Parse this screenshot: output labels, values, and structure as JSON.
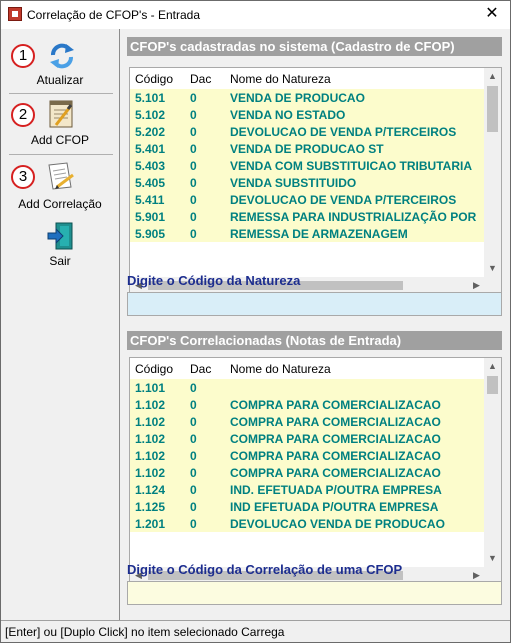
{
  "window": {
    "title": "Correlação de CFOP's - Entrada",
    "close_symbol": "✕"
  },
  "sidebar": {
    "buttons": [
      {
        "number": "1",
        "label": "Atualizar",
        "icon": "refresh-icon"
      },
      {
        "number": "2",
        "label": "Add CFOP",
        "icon": "notepad-icon"
      },
      {
        "number": "3",
        "label": "Add Correlação",
        "icon": "edit-document-icon"
      },
      {
        "number": "",
        "label": "Sair",
        "icon": "exit-door-icon"
      }
    ]
  },
  "cfop_cadastradas": {
    "title": "CFOP's cadastradas no sistema (Cadastro de CFOP)",
    "columns": [
      "Código",
      "Dac",
      "Nome do Natureza"
    ],
    "rows": [
      {
        "codigo": "5.101",
        "dac": "0",
        "nome": "VENDA DE PRODUCAO"
      },
      {
        "codigo": "5.102",
        "dac": "0",
        "nome": "VENDA NO ESTADO"
      },
      {
        "codigo": "5.202",
        "dac": "0",
        "nome": "DEVOLUCAO DE VENDA P/TERCEIROS"
      },
      {
        "codigo": "5.401",
        "dac": "0",
        "nome": "VENDA DE PRODUCAO ST"
      },
      {
        "codigo": "5.403",
        "dac": "0",
        "nome": "VENDA COM SUBSTITUICAO TRIBUTARIA"
      },
      {
        "codigo": "5.405",
        "dac": "0",
        "nome": "VENDA SUBSTITUIDO"
      },
      {
        "codigo": "5.411",
        "dac": "0",
        "nome": "DEVOLUCAO DE VENDA P/TERCEIROS"
      },
      {
        "codigo": "5.901",
        "dac": "0",
        "nome": "REMESSA PARA INDUSTRIALIZAÇÃO POR"
      },
      {
        "codigo": "5.905",
        "dac": "0",
        "nome": "REMESSA DE ARMAZENAGEM"
      }
    ]
  },
  "natureza_input": {
    "label": "Digite o Código da Natureza",
    "value": "",
    "background": "#d9eef8"
  },
  "cfop_correlacionadas": {
    "title": "CFOP's Correlacionadas (Notas de Entrada)",
    "columns": [
      "Código",
      "Dac",
      "Nome do Natureza"
    ],
    "rows": [
      {
        "codigo": "1.101",
        "dac": "0",
        "nome": ""
      },
      {
        "codigo": "1.102",
        "dac": "0",
        "nome": "COMPRA PARA COMERCIALIZACAO"
      },
      {
        "codigo": "1.102",
        "dac": "0",
        "nome": "COMPRA PARA COMERCIALIZACAO"
      },
      {
        "codigo": "1.102",
        "dac": "0",
        "nome": "COMPRA PARA COMERCIALIZACAO"
      },
      {
        "codigo": "1.102",
        "dac": "0",
        "nome": "COMPRA PARA COMERCIALIZACAO"
      },
      {
        "codigo": "1.102",
        "dac": "0",
        "nome": "COMPRA PARA COMERCIALIZACAO"
      },
      {
        "codigo": "1.124",
        "dac": "0",
        "nome": "IND. EFETUADA P/OUTRA  EMPRESA"
      },
      {
        "codigo": "1.125",
        "dac": "0",
        "nome": "IND EFETUADA P/OUTRA EMPRESA"
      },
      {
        "codigo": "1.201",
        "dac": "0",
        "nome": "DEVOLUCAO VENDA DE PRODUCAO"
      }
    ]
  },
  "correlacao_input": {
    "label": "Digite o Código da Correlação de uma CFOP",
    "value": "",
    "background": "#fcfce0"
  },
  "statusbar": {
    "text": "[Enter] ou [Duplo Click] no item selecionado Carrega"
  },
  "colors": {
    "row_background": "#fcfccc",
    "row_text": "#008080",
    "section_header": "#a0a0a0",
    "label_text": "#1c2d8f",
    "step_circle": "#d62020"
  }
}
